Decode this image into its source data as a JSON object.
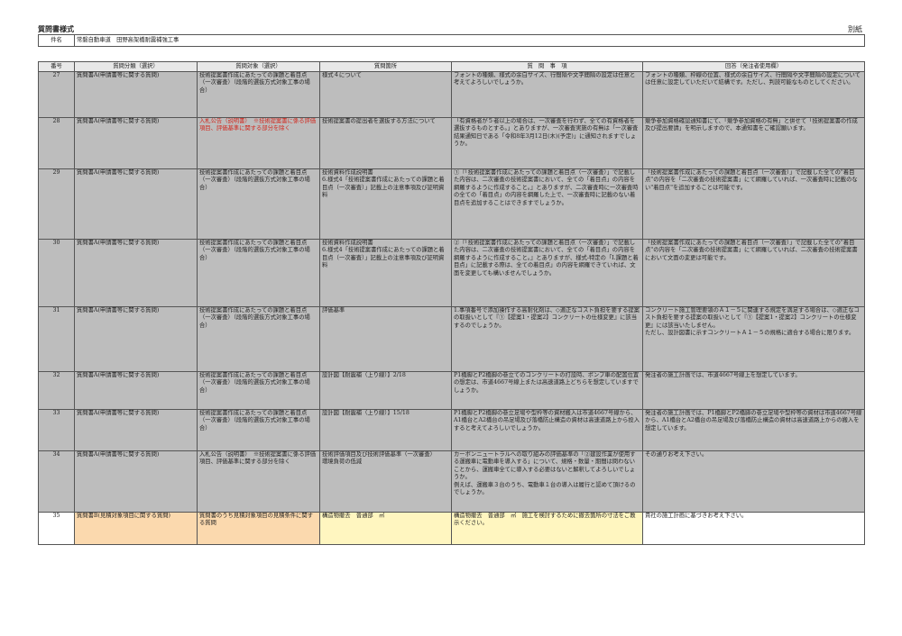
{
  "header": {
    "title": "質問書様式",
    "sheet_label": "別紙"
  },
  "subject": {
    "label": "件名",
    "value": "常磐自動車道　田野高架橋耐震補強工事"
  },
  "columns": [
    "番号",
    "質問分類（選択）",
    "質問対象（選択）",
    "質問箇所",
    "質　問　事　項",
    "回答（発注者使用欄）"
  ],
  "rows": [
    {
      "no": "27",
      "category": "質問書A(申請書等に関する質問)",
      "target": "技術提案書作成にあたっての課題と着目点（一次審査）（段階的選抜方式対象工事の場合）",
      "location": "様式４について",
      "question": "フォントの種類、様式の余白サイズ、行間隔や文字間隔の設定は任意と考えてよろしいでしょうか。",
      "answer": "フォントの種類、枠線の位置、様式の余白サイズ、行間隔や文字間隔の設定については任意に設定していただいて結構です。ただし、判読可能なものとしてください。"
    },
    {
      "no": "28",
      "category": "質問書A(申請書等に関する質問)",
      "target": "入札公告（説明書）　※技術提案書に係る評価項目、評価基準に関する部分を除く",
      "location": "技術提案書の提出者を選抜する方法について",
      "question": "「有資格者が５者以上の場合は、一次審査を行わず、全ての有資格者を選抜するものとする。」とありますが、一次審査実施の有無は「一次審査結果通知日である「令和8年3月12日(木)(予定)」に通知されますでしょうか。",
      "answer": "競争参加資格確認通知書にて、「競争参加資格の有無」と併せて「技術提案書の作成及び提出要請」を明示しますので、本通知書をご確認願います。"
    },
    {
      "no": "29",
      "category": "質問書A(申請書等に関する質問)",
      "target": "技術提案書作成にあたっての課題と着目点（一次審査）（段階的選抜方式対象工事の場合）",
      "location": "技術資料作成説明書\n6.様式4「技術提案書作成にあたっての課題と着目点（一次審査）」記載上の注意事項及び証明資料",
      "question": "①『「技術提案書作成にあたっての課題と着目点（一次審査）」で記載した内容は、二次審査の技術提案書において、全ての「着目点」の内容を網羅するように作成すること。』とありますが、二次審査時に一次審査時の全ての「着目点」の内容を網羅した上で、一次審査時に記載のない着目点を追加することはできますでしょうか。",
      "answer": "「技術提案書作成にあたっての課題と着目点（一次審査）」で記載した全ての\"着目点\"の内容を「二次審査の技術提案書」にて網羅していれば、一次審査時に記載のない\"着目点\"を追加することは可能です。"
    },
    {
      "no": "30",
      "category": "質問書A(申請書等に関する質問)",
      "target": "技術提案書作成にあたっての課題と着目点（一次審査）（段階的選抜方式対象工事の場合）",
      "location": "技術資料作成説明書\n6.様式4「技術提案書作成にあたっての課題と着目点（一次審査）」記載上の注意事項及び証明資料",
      "question": "②『「技術提案書作成にあたっての課題と着目点（一次審査）」で記載した内容は、二次審査の技術提案書において、全ての「着目点」の内容を網羅するように作成すること。』とありますが、様式-特定の「Ⅰ.課題と着目点」に記載する際は、全ての着目点」の内容を網羅できていれば、文面を変更しても構いませんでしょうか。",
      "answer": "「技術提案書作成にあたっての課題と着目点（一次審査）」で記載した全ての\"着目点\"の内容を「二次審査の技術提案書」にて網羅していれば、二次審査の技術提案書において文面の変更は可能です。"
    },
    {
      "no": "31",
      "category": "質問書A(申請書等に関する質問)",
      "target": "技術提案書作成にあたっての課題と着目点（一次審査）（段階的選抜方式対象工事の場合）",
      "location": "評価基準",
      "question": "1.事項番号で添加操作する高耐化剤は、◇適正なコスト負担を要する提案の取扱いとして『①【提案1・提案2】コンクリートの仕様変更』に該当するのでしょうか。",
      "answer": "コンクリート施工管理要領のＡ１－５に関連する規定を満足する場合は、◇適正なコスト負担を要する提案の取扱いとして『①【提案1・提案2】コンクリートの仕様変更』には該当いたしません。\nただし、設計図書に示すコンクリートＡ１－５の規格に適合する場合に限ります。"
    },
    {
      "no": "32",
      "category": "質問書A(申請書等に関する質問)",
      "target": "技術提案書作成にあたっての課題と着目点（一次審査）（段階的選抜方式対象工事の場合）",
      "location": "設計図【耐震補（上り線）】2/18",
      "question": "P1橋脚とP2橋脚の巻立てのコンクリートの打設時、ポンプ車の配置位置の想定は、市道4667号線上または高速道路上どちらを想定していますでしょうか。",
      "answer": "発注者の施工計画では、市道4667号線上を想定しています。"
    },
    {
      "no": "33",
      "category": "質問書A(申請書等に関する質問)",
      "target": "技術提案書作成にあたっての課題と着目点（一次審査）（段階的選抜方式対象工事の場合）",
      "location": "設計図【耐震補（上り線）】15/18",
      "question": "P1橋脚とP2橋脚の巻立足場や型枠等の資材搬入は市道4667号線から、A1橋台とA2橋台の吊足場及び落橋防止構造の資材は高速道路上から投入すると考えてよろしいでしょうか。",
      "answer": "発注者の施工計画では、P1橋脚とP2橋脚の巻立足場や型枠等の資材は市道4667号線から、A1橋台とA2橋台の吊足場及び落橋防止構造の資材は高速道路上からの搬入を想定しています。"
    },
    {
      "no": "34",
      "category": "質問書A(申請書等に関する質問)",
      "target": "入札公告（説明書）　※技術提案書に係る評価項目、評価基準に関する部分を除く",
      "location": "技術評価項目及び技術評価基準（一次審査）\n環境負荷の低減",
      "question": "カーボンニュートラルへの取り組みの評価基準の「②建設作業が使用する運搬車に電動車を導入する」について、規格・数量・期間は問わないことから、運搬車全てに導入する必要はないと解釈してよろしいでしょうか。\n例えば、運搬車３台のうち、電動車１台の導入は履行と認めて頂けるのでしょうか。",
      "answer": "その通りお考え下さい。"
    },
    {
      "no": "35",
      "category": "質問書B(見積対象項目に関する質問)",
      "target": "質問書のうち見積対象項目の見積条件に関する質問",
      "location": "構造物撤去　普通部　㎥",
      "question": "構造物撤去　普通部　㎥　施工を検討するために撤去箇所の寸法をご教示ください。",
      "answer": "貴社の施工計画に基づきお考え下さい。"
    }
  ]
}
